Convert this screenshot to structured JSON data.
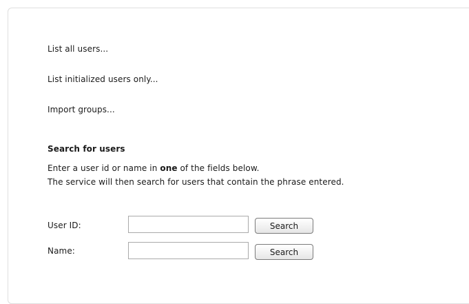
{
  "links": {
    "list_all": "List all users...",
    "list_initialized": "List initialized users only...",
    "import_groups": "Import groups..."
  },
  "search": {
    "title": "Search for users",
    "desc_prefix": "Enter a user id or name in ",
    "desc_emphasis": "one",
    "desc_suffix": " of the fields below.",
    "desc_line2": "The service will then search for users that contain the phrase entered.",
    "user_id_label": "User ID:",
    "user_id_value": "",
    "name_label": "Name:",
    "name_value": "",
    "button_label": "Search"
  }
}
